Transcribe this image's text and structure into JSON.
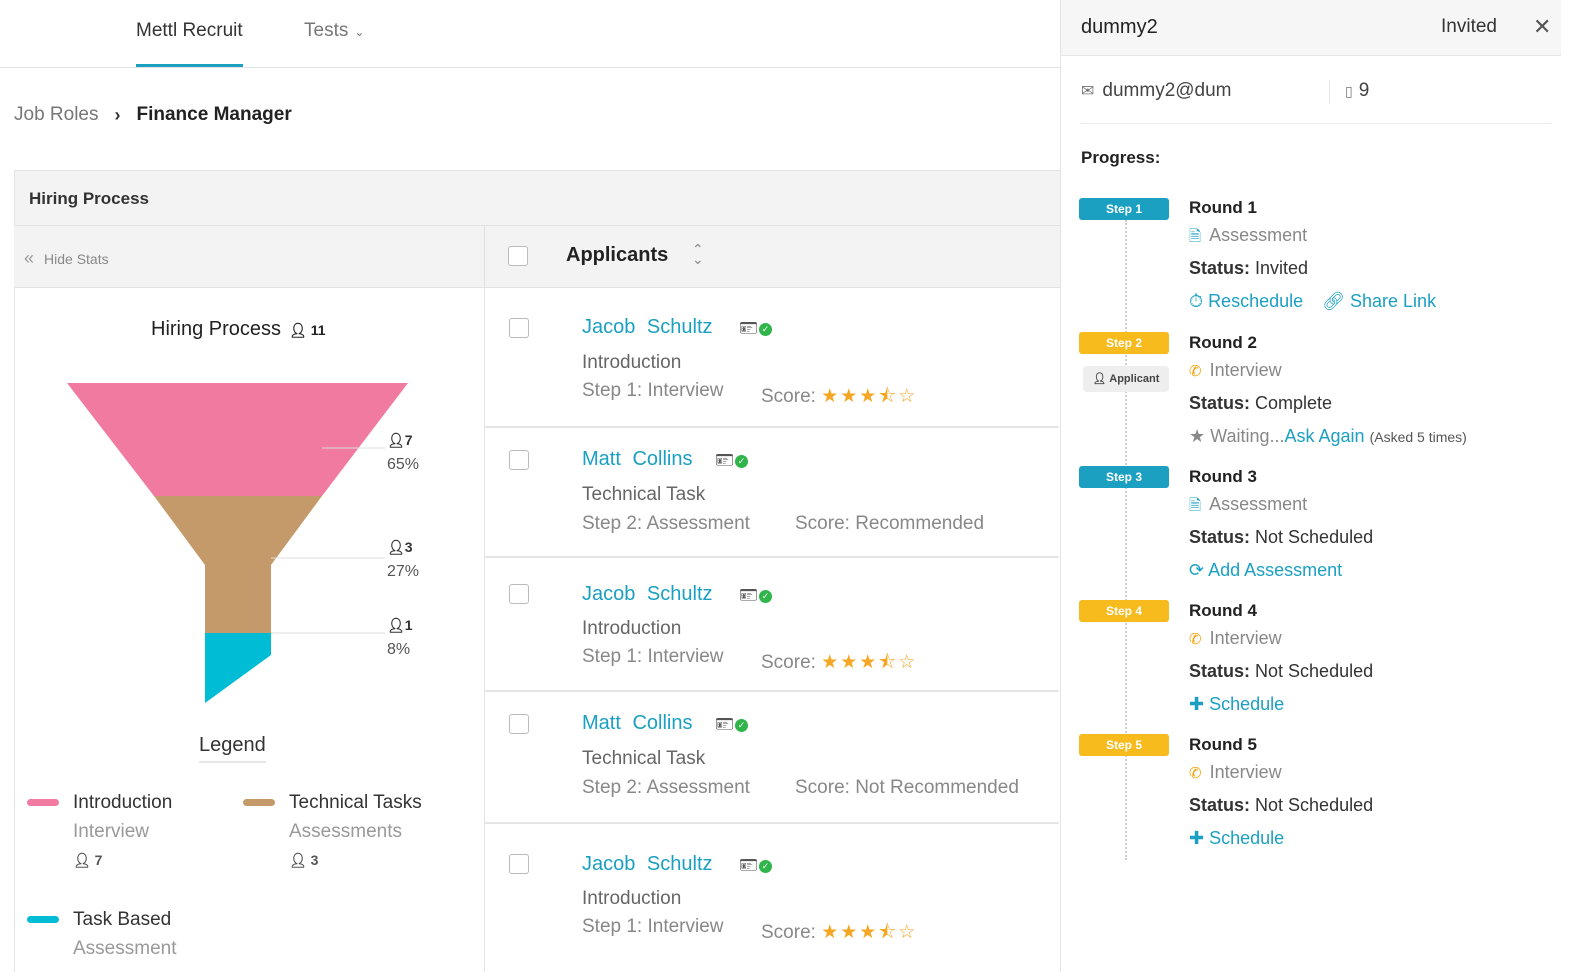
{
  "nav": {
    "app_tab": "Mettl Recruit",
    "tests_tab": "Tests"
  },
  "breadcrumb": {
    "parent": "Job Roles",
    "current": "Finance Manager"
  },
  "panel": {
    "title": "Hiring Process",
    "hide_stats": "Hide Stats",
    "applicants_header": "Applicants"
  },
  "stats": {
    "title": "Hiring Process",
    "total": "11",
    "funnel": [
      {
        "count": "7",
        "percent": "65%",
        "color": "#f07aa0"
      },
      {
        "count": "3",
        "percent": "27%",
        "color": "#c59a6a"
      },
      {
        "count": "1",
        "percent": "8%",
        "color": "#00bcd4"
      }
    ],
    "legend_title": "Legend",
    "legend": [
      {
        "name": "Introduction",
        "sub": "Interview",
        "count": "7",
        "color": "#f07aa0"
      },
      {
        "name": "Technical Tasks",
        "sub": "Assessments",
        "count": "3",
        "color": "#c59a6a"
      },
      {
        "name": "Task Based",
        "sub": "Assessment",
        "color": "#00bcd4"
      }
    ]
  },
  "applicants": [
    {
      "name": "Jacob Schultz",
      "stage": "Introduction",
      "step": "Step 1: Interview",
      "score_label": "Score:",
      "stars": "★★★⯪☆"
    },
    {
      "name": "Matt Collins",
      "stage": "Technical Task",
      "step": "Step 2: Assessment",
      "score_label": "Score: Recommended"
    },
    {
      "name": "Jacob Schultz",
      "stage": "Introduction",
      "step": "Step 1: Interview",
      "score_label": "Score:",
      "stars": "★★★⯪☆"
    },
    {
      "name": "Matt Collins",
      "stage": "Technical Task",
      "step": "Step 2: Assessment",
      "score_label": "Score: Not Recommended"
    },
    {
      "name": "Jacob Schultz",
      "stage": "Introduction",
      "step": "Step 1: Interview",
      "score_label": "Score:",
      "stars": "★★★⯪☆"
    }
  ],
  "candidate": {
    "name": "dummy2",
    "status": "Invited",
    "email": "dummy2@dum",
    "phone": "9",
    "progress_label": "Progress:",
    "applicant_tag": "Applicant",
    "rounds": [
      {
        "step": "Step 1",
        "title": "Round 1",
        "type": "Assessment",
        "status_label": "Status:",
        "status": "Invited",
        "action1": "Reschedule",
        "action2": "Share Link"
      },
      {
        "step": "Step 2",
        "title": "Round 2",
        "type": "Interview",
        "status_label": "Status:",
        "status": "Complete",
        "waiting": "Waiting...",
        "action1": "Ask Again",
        "asked": "(Asked 5 times)"
      },
      {
        "step": "Step 3",
        "title": "Round 3",
        "type": "Assessment",
        "status_label": "Status:",
        "status": "Not Scheduled",
        "action1": "Add Assessment"
      },
      {
        "step": "Step 4",
        "title": "Round 4",
        "type": "Interview",
        "status_label": "Status:",
        "status": "Not Scheduled",
        "action1": "Schedule"
      },
      {
        "step": "Step 5",
        "title": "Round 5",
        "type": "Interview",
        "status_label": "Status:",
        "status": "Not Scheduled",
        "action1": "Schedule"
      }
    ]
  }
}
